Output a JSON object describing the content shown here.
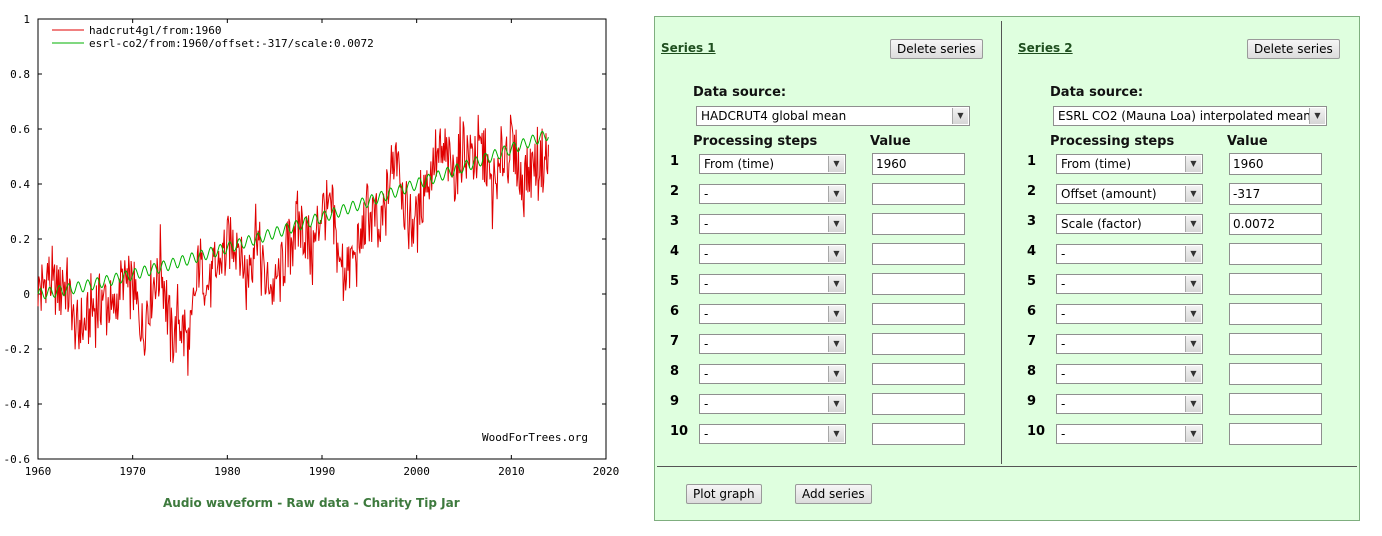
{
  "chart_data": {
    "type": "line",
    "xlim": [
      1960,
      2020
    ],
    "ylim": [
      -0.6,
      1
    ],
    "x_ticks": [
      "1960",
      "1970",
      "1980",
      "1990",
      "2000",
      "2010",
      "2020"
    ],
    "y_ticks": [
      "1",
      "0.8",
      "0.6",
      "0.4",
      "0.2",
      "0",
      "-0.2",
      "-0.4",
      "-0.6"
    ],
    "watermark": "WoodForTrees.org",
    "legend_position": "top-left",
    "series": [
      {
        "name": "hadcrut4gl/from:1960",
        "color": "#e00000",
        "x": [
          1960.0,
          1961.0,
          1962.0,
          1963.0,
          1964.0,
          1965.0,
          1966.0,
          1967.0,
          1968.0,
          1969.0,
          1970.0,
          1971.0,
          1972.0,
          1973.0,
          1974.0,
          1975.0,
          1976.0,
          1977.0,
          1978.0,
          1979.0,
          1980.0,
          1981.0,
          1982.0,
          1983.0,
          1984.0,
          1985.0,
          1986.0,
          1987.0,
          1988.0,
          1989.0,
          1990.0,
          1991.0,
          1992.0,
          1993.0,
          1994.0,
          1995.0,
          1996.0,
          1997.0,
          1998.0,
          1999.0,
          2000.0,
          2001.0,
          2002.0,
          2003.0,
          2004.0,
          2005.0,
          2006.0,
          2007.0,
          2008.0,
          2009.0,
          2010.0,
          2011.0,
          2012.0,
          2013.0,
          2013.9
        ],
        "y": [
          0.0,
          0.05,
          0.03,
          0.04,
          -0.15,
          -0.1,
          -0.05,
          -0.02,
          -0.07,
          0.05,
          0.02,
          -0.12,
          0.0,
          0.12,
          -0.15,
          -0.08,
          -0.22,
          0.12,
          0.03,
          0.1,
          0.16,
          0.22,
          0.04,
          0.24,
          0.03,
          0.02,
          0.1,
          0.24,
          0.25,
          0.15,
          0.32,
          0.3,
          0.08,
          0.1,
          0.18,
          0.32,
          0.2,
          0.38,
          0.55,
          0.26,
          0.28,
          0.4,
          0.5,
          0.5,
          0.45,
          0.55,
          0.5,
          0.52,
          0.35,
          0.48,
          0.55,
          0.41,
          0.45,
          0.48,
          0.5
        ]
      },
      {
        "name": "esrl-co2/from:1960/offset:-317/scale:0.0072",
        "color": "#00b000",
        "x": [
          1960.0,
          2013.9
        ],
        "y": [
          0.0,
          0.58
        ],
        "seasonal_amplitude": 0.02
      }
    ]
  },
  "footer_links": [
    "Audio waveform",
    "Raw data",
    "Charity Tip Jar"
  ],
  "footer_separator": "-",
  "panel": {
    "col_processing": "Processing steps",
    "col_value": "Value",
    "data_source_label": "Data source:",
    "plot_button": "Plot graph",
    "add_button": "Add series",
    "series": [
      {
        "title": "Series 1",
        "delete_label": "Delete series",
        "source": "HADCRUT4 global mean",
        "steps": [
          {
            "num": "1",
            "type": "From (time)",
            "value": "1960"
          },
          {
            "num": "2",
            "type": "-",
            "value": ""
          },
          {
            "num": "3",
            "type": "-",
            "value": ""
          },
          {
            "num": "4",
            "type": "-",
            "value": ""
          },
          {
            "num": "5",
            "type": "-",
            "value": ""
          },
          {
            "num": "6",
            "type": "-",
            "value": ""
          },
          {
            "num": "7",
            "type": "-",
            "value": ""
          },
          {
            "num": "8",
            "type": "-",
            "value": ""
          },
          {
            "num": "9",
            "type": "-",
            "value": ""
          },
          {
            "num": "10",
            "type": "-",
            "value": ""
          }
        ]
      },
      {
        "title": "Series 2",
        "delete_label": "Delete series",
        "source": "ESRL CO2 (Mauna Loa) interpolated mean",
        "steps": [
          {
            "num": "1",
            "type": "From (time)",
            "value": "1960"
          },
          {
            "num": "2",
            "type": "Offset (amount)",
            "value": "-317"
          },
          {
            "num": "3",
            "type": "Scale (factor)",
            "value": "0.0072"
          },
          {
            "num": "4",
            "type": "-",
            "value": ""
          },
          {
            "num": "5",
            "type": "-",
            "value": ""
          },
          {
            "num": "6",
            "type": "-",
            "value": ""
          },
          {
            "num": "7",
            "type": "-",
            "value": ""
          },
          {
            "num": "8",
            "type": "-",
            "value": ""
          },
          {
            "num": "9",
            "type": "-",
            "value": ""
          },
          {
            "num": "10",
            "type": "-",
            "value": ""
          }
        ]
      }
    ]
  }
}
